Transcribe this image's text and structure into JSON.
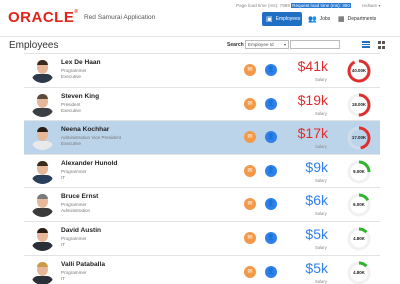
{
  "header": {
    "logo": "ORACLE",
    "app_title": "Red Samurai Application",
    "load_time_label": "Page load time (ms): 7989",
    "load_time_highlight": "Request load time (ms): 350",
    "user_menu": "redsam",
    "nav": [
      {
        "label": "Employees",
        "icon": "person-card-icon",
        "active": true
      },
      {
        "label": "Jobs",
        "icon": "people-icon",
        "active": false
      },
      {
        "label": "Departments",
        "icon": "building-icon",
        "active": false
      }
    ]
  },
  "subbar": {
    "title": "Employees",
    "search_label": "Search",
    "search_field": "Employee Id"
  },
  "employees": [
    {
      "name": "Lex De Haan",
      "job": "Programmer",
      "dept": "Executive",
      "salary": "$41k",
      "salary_label": "Salary",
      "gauge_label": "40.00K",
      "gauge_fraction": 0.92,
      "gauge_color": "#e02d2d",
      "selected": false,
      "salary_color": "#e02d2d"
    },
    {
      "name": "Steven King",
      "job": "President",
      "dept": "Executive",
      "salary": "$19k",
      "salary_label": "Salary",
      "gauge_label": "18.00K",
      "gauge_fraction": 0.5,
      "gauge_color": "#e02d2d",
      "selected": false,
      "salary_color": "#e02d2d"
    },
    {
      "name": "Neena Kochhar",
      "job": "Administration Vice President",
      "dept": "Executive",
      "salary": "$17k",
      "salary_label": "Salary",
      "gauge_label": "17.00K",
      "gauge_fraction": 0.47,
      "gauge_color": "#e02d2d",
      "selected": true,
      "salary_color": "#e02d2d"
    },
    {
      "name": "Alexander Hunold",
      "job": "Programmer",
      "dept": "IT",
      "salary": "$9k",
      "salary_label": "Salary",
      "gauge_label": "9.00K",
      "gauge_fraction": 0.25,
      "gauge_color": "#2bb52b",
      "selected": false,
      "salary_color": "#2f80ed"
    },
    {
      "name": "Bruce Ernst",
      "job": "Programmer",
      "dept": "Administration",
      "salary": "$6k",
      "salary_label": "Salary",
      "gauge_label": "6.00K",
      "gauge_fraction": 0.17,
      "gauge_color": "#2bb52b",
      "selected": false,
      "salary_color": "#2f80ed"
    },
    {
      "name": "David Austin",
      "job": "Programmer",
      "dept": "IT",
      "salary": "$5k",
      "salary_label": "Salary",
      "gauge_label": "4.80K",
      "gauge_fraction": 0.13,
      "gauge_color": "#2bb52b",
      "selected": false,
      "salary_color": "#2f80ed"
    },
    {
      "name": "Valli Pataballa",
      "job": "Programmer",
      "dept": "IT",
      "salary": "$5k",
      "salary_label": "Salary",
      "gauge_label": "4.80K",
      "gauge_fraction": 0.13,
      "gauge_color": "#2bb52b",
      "selected": false,
      "salary_color": "#2f80ed"
    }
  ]
}
